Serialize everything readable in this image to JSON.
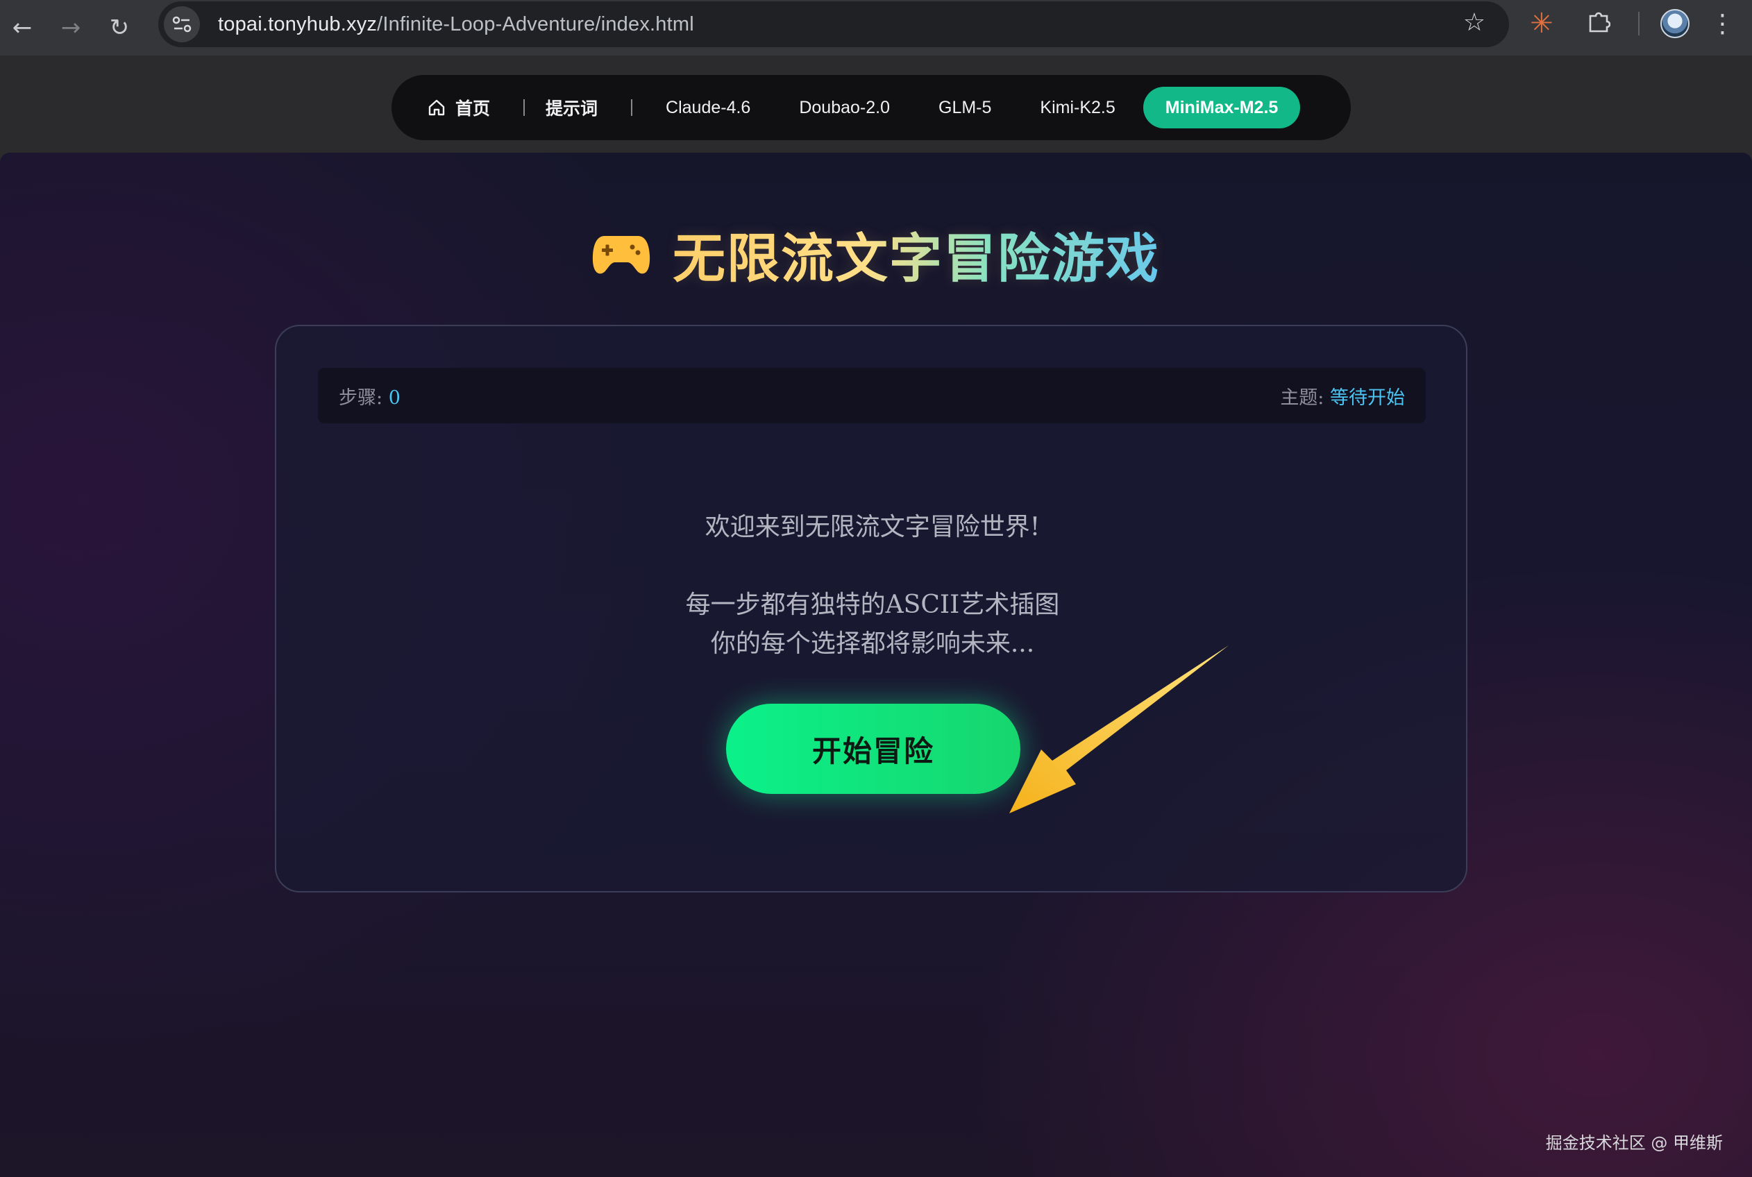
{
  "browser": {
    "url_host": "topai.tonyhub.xyz",
    "url_path": "/Infinite-Loop-Adventure/index.html",
    "icons": [
      "back-icon",
      "forward-icon",
      "reload-icon",
      "site-info-icon",
      "star-icon",
      "extension-burst-icon",
      "puzzle-icon",
      "avatar",
      "more-icon"
    ]
  },
  "nav": {
    "items": [
      {
        "label": "首页",
        "icon": "home-icon"
      },
      {
        "label": "提示词"
      },
      {
        "label": "Claude-4.6"
      },
      {
        "label": "Doubao-2.0"
      },
      {
        "label": "GLM-5"
      },
      {
        "label": "Kimi-K2.5"
      },
      {
        "label": "MiniMax-M2.5",
        "active": true
      }
    ],
    "active_color": "#13b889"
  },
  "game": {
    "title": "无限流文字冒险游戏",
    "title_icon": "gamepad-icon",
    "status": {
      "step_label": "步骤: ",
      "step_value": "0",
      "theme_label": "主题: ",
      "theme_value": "等待开始"
    },
    "welcome": "欢迎来到无限流文字冒险世界!",
    "desc_line1": "每一步都有独特的ASCII艺术插图",
    "desc_line2": "你的每个选择都将影响未来...",
    "start_button": "开始冒险",
    "accent_color": "#0bf18a"
  },
  "watermark": "掘金技术社区 @ 甲维斯"
}
